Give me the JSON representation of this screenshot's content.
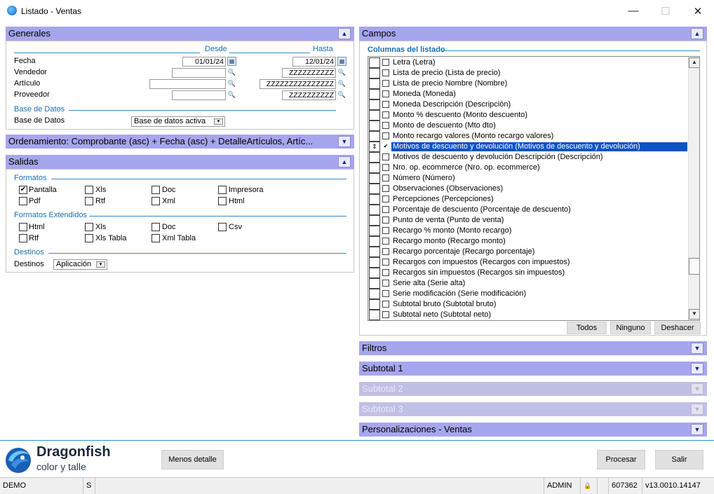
{
  "window": {
    "title": "Listado - Ventas",
    "controls": {
      "minimize": "—",
      "maximize": "☐",
      "close": "✕"
    }
  },
  "generales": {
    "header": "Generales",
    "desde_label": "Desde",
    "hasta_label": "Hasta",
    "fields": [
      {
        "label": "Fecha",
        "desde": "01/01/24",
        "hasta": "12/01/24"
      },
      {
        "label": "Vendedor",
        "desde": "",
        "hasta": "ZZZZZZZZZZ"
      },
      {
        "label": "Artículo",
        "desde": "",
        "hasta": "ZZZZZZZZZZZZZZZ"
      },
      {
        "label": "Proveedor",
        "desde": "",
        "hasta": "ZZZZZZZZZZ"
      }
    ],
    "base_section": "Base de Datos",
    "base_label": "Base de Datos",
    "base_value": "Base de datos activa"
  },
  "ordenamiento": {
    "header": "Ordenamiento: Comprobante (asc) + Fecha (asc) + DetalleArtículos, Artíc..."
  },
  "salidas": {
    "header": "Salidas",
    "formatos_label": "Formatos",
    "formatos": [
      {
        "label": "Pantalla",
        "checked": true
      },
      {
        "label": "Xls",
        "checked": false
      },
      {
        "label": "Doc",
        "checked": false
      },
      {
        "label": "Impresora",
        "checked": false
      },
      {
        "label": "Pdf",
        "checked": false
      },
      {
        "label": "Rtf",
        "checked": false
      },
      {
        "label": "Xml",
        "checked": false
      },
      {
        "label": "Html",
        "checked": false
      }
    ],
    "extendidos_label": "Formatos Extendidos",
    "extendidos": [
      {
        "label": "Html",
        "checked": false
      },
      {
        "label": "Xls",
        "checked": false
      },
      {
        "label": "Doc",
        "checked": false
      },
      {
        "label": "Csv",
        "checked": false
      },
      {
        "label": "Rtf",
        "checked": false
      },
      {
        "label": "Xls Tabla",
        "checked": false
      },
      {
        "label": "Xml Tabla",
        "checked": false
      }
    ],
    "destinos_section": "Destinos",
    "destinos_label": "Destinos",
    "destinos_value": "Aplicación"
  },
  "campos": {
    "header": "Campos",
    "columnas_label": "Columnas del listado",
    "items": [
      {
        "label": "Letra (Letra)",
        "checked": false,
        "selected": false
      },
      {
        "label": "Lista de precio (Lista de precio)",
        "checked": false,
        "selected": false
      },
      {
        "label": "Lista de precio Nombre (Nombre)",
        "checked": false,
        "selected": false
      },
      {
        "label": "Moneda (Moneda)",
        "checked": false,
        "selected": false
      },
      {
        "label": "Moneda Descripción (Descripción)",
        "checked": false,
        "selected": false
      },
      {
        "label": "Monto % descuento (Monto descuento)",
        "checked": false,
        "selected": false
      },
      {
        "label": "Monto de descuento (Mto dto)",
        "checked": false,
        "selected": false
      },
      {
        "label": "Monto recargo valores (Monto recargo valores)",
        "checked": false,
        "selected": false
      },
      {
        "label": "Motivos de descuento y devolución (Motivos de descuento y devolución)",
        "checked": true,
        "selected": true
      },
      {
        "label": "Motivos de descuento y devolución Descripción (Descripción)",
        "checked": false,
        "selected": false
      },
      {
        "label": "Nro. op. ecommerce (Nro. op. ecommerce)",
        "checked": false,
        "selected": false
      },
      {
        "label": "Número (Número)",
        "checked": false,
        "selected": false
      },
      {
        "label": "Observaciones (Observaciones)",
        "checked": false,
        "selected": false
      },
      {
        "label": "Percepciones (Percepciones)",
        "checked": false,
        "selected": false
      },
      {
        "label": "Porcentaje de descuento (Porcentaje de descuento)",
        "checked": false,
        "selected": false
      },
      {
        "label": "Punto de venta (Punto de venta)",
        "checked": false,
        "selected": false
      },
      {
        "label": "Recargo % monto (Monto recargo)",
        "checked": false,
        "selected": false
      },
      {
        "label": "Recargo monto (Recargo monto)",
        "checked": false,
        "selected": false
      },
      {
        "label": "Recargo porcentaje (Recargo porcentaje)",
        "checked": false,
        "selected": false
      },
      {
        "label": "Recargos con impuestos (Recargos con impuestos)",
        "checked": false,
        "selected": false
      },
      {
        "label": "Recargos sin impuestos (Recargos sin impuestos)",
        "checked": false,
        "selected": false
      },
      {
        "label": "Serie alta (Serie alta)",
        "checked": false,
        "selected": false
      },
      {
        "label": "Serie modificación (Serie modificación)",
        "checked": false,
        "selected": false
      },
      {
        "label": "Subtotal bruto (Subtotal bruto)",
        "checked": false,
        "selected": false
      },
      {
        "label": "Subtotal neto (Subtotal neto)",
        "checked": false,
        "selected": false
      }
    ],
    "buttons": {
      "todos": "Todos",
      "ninguno": "Ninguno",
      "deshacer": "Deshacer"
    }
  },
  "right_panels": [
    {
      "header": "Filtros",
      "enabled": true
    },
    {
      "header": "Subtotal 1",
      "enabled": true
    },
    {
      "header": "Subtotal 2",
      "enabled": false
    },
    {
      "header": "Subtotal 3",
      "enabled": false
    },
    {
      "header": "Personalizaciones - Ventas",
      "enabled": true
    }
  ],
  "footer": {
    "logo_name": "Dragonfish",
    "logo_tagline": "color y talle",
    "menos_detalle": "Menos detalle",
    "procesar": "Procesar",
    "salir": "Salir"
  },
  "status": {
    "company": "DEMO",
    "mode": "S",
    "user": "ADMIN",
    "lock": "🔒",
    "number": "607362",
    "version": "v13.0010.14147"
  },
  "icons": {
    "collapse": "⯭",
    "expand": "⯯"
  }
}
